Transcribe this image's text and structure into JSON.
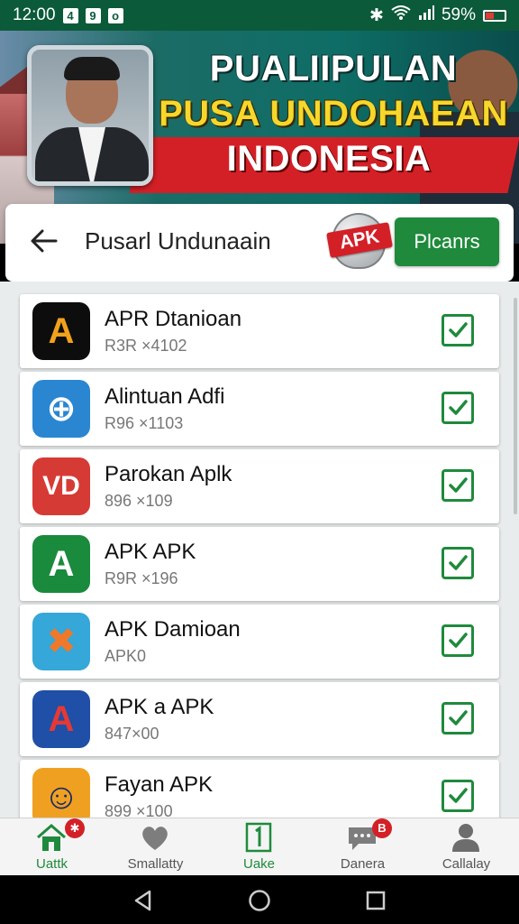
{
  "status_bar": {
    "time": "12:00",
    "left_glyphs": [
      "4",
      "9",
      "o"
    ],
    "battery": "59%"
  },
  "banner": {
    "line1": "PUALIIPULAN",
    "line2": "PUSA UNDOHAEAN",
    "line3": "INDONESIA"
  },
  "header": {
    "title": "Pusarl Undunaain",
    "apk_badge": "APK",
    "primary_button": "Plcanrs"
  },
  "apps": [
    {
      "name": "APR Dtanioan",
      "meta": "R3R ×4102",
      "icon": "a-logo-icon",
      "glyph": "A",
      "bg": "#0d0d0d",
      "fg": "#f1a11c",
      "checked": true
    },
    {
      "name": "Alintuan Adfi",
      "meta": "R96 ×1103",
      "icon": "globe-icon",
      "glyph": "⊕",
      "bg": "#2a86d1",
      "fg": "#ffffff",
      "checked": true
    },
    {
      "name": "Parokan Aplk",
      "meta": "896 ×109",
      "icon": "vd-logo-icon",
      "glyph": "VD",
      "bg": "#d63a35",
      "fg": "#ffffff",
      "checked": true
    },
    {
      "name": "APK APK",
      "meta": "R9R ×196",
      "icon": "a-green-icon",
      "glyph": "A",
      "bg": "#1a8a3c",
      "fg": "#ffffff",
      "checked": true
    },
    {
      "name": "APK Damioan",
      "meta": "APK0",
      "icon": "x-logo-icon",
      "glyph": "✖",
      "bg": "#35a7d8",
      "fg": "#f0782a",
      "checked": true
    },
    {
      "name": "APK a APK",
      "meta": "847×00",
      "icon": "a-blue-icon",
      "glyph": "A",
      "bg": "#1f4fa6",
      "fg": "#e53935",
      "checked": true
    },
    {
      "name": "Fayan APK",
      "meta": "899 ×100",
      "icon": "person-icon",
      "glyph": "☺",
      "bg": "#f0a020",
      "fg": "#1a2a6a",
      "checked": true
    }
  ],
  "bottom_nav": [
    {
      "label": "Uattk",
      "icon": "home-icon",
      "badge": "✱",
      "active": true
    },
    {
      "label": "Smallatty",
      "icon": "heart-icon",
      "badge": "",
      "active": false
    },
    {
      "label": "Uake",
      "icon": "number-one-icon",
      "badge": "",
      "active": true
    },
    {
      "label": "Danera",
      "icon": "chat-icon",
      "badge": "B",
      "active": false
    },
    {
      "label": "Callalay",
      "icon": "profile-icon",
      "badge": "",
      "active": false
    }
  ],
  "colors": {
    "accent": "#1f8a3c",
    "status_bar": "#0b5a3a",
    "badge_red": "#d32027"
  }
}
